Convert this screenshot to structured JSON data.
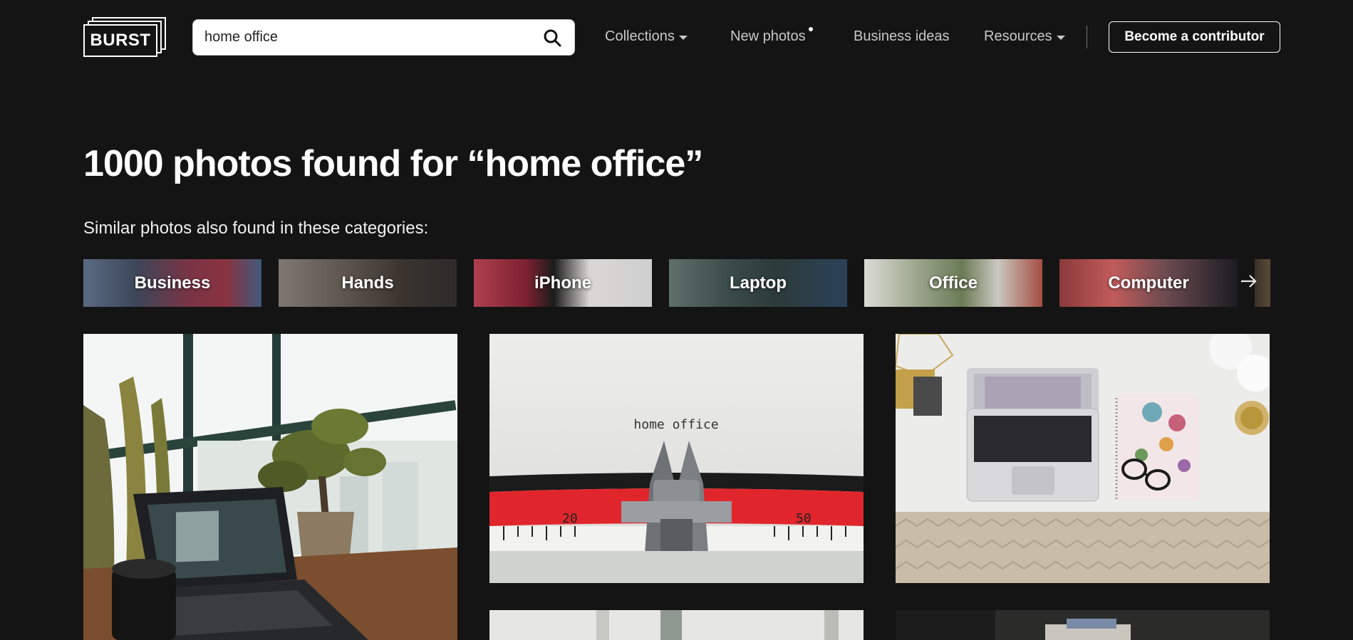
{
  "header": {
    "logo_text": "BURST",
    "search": {
      "value": "home office",
      "placeholder": "Search"
    },
    "nav": [
      {
        "label": "Collections",
        "has_dropdown": true
      },
      {
        "label": "New photos",
        "has_dot": true
      },
      {
        "label": "Business ideas"
      },
      {
        "label": "Resources",
        "has_dropdown": true
      }
    ],
    "cta_label": "Become a contributor"
  },
  "results": {
    "title": "1000 photos found for “home office”",
    "subtitle": "Similar photos also found in these categories:"
  },
  "categories": [
    "Business",
    "Hands",
    "iPhone",
    "Laptop",
    "Office",
    "Computer"
  ],
  "photos": [
    {
      "caption_text": "home office",
      "ruler_left": "20",
      "ruler_right": "50"
    }
  ],
  "colors": {
    "background": "#141414",
    "text": "#ffffff",
    "nav_text": "#c8c8c8"
  }
}
